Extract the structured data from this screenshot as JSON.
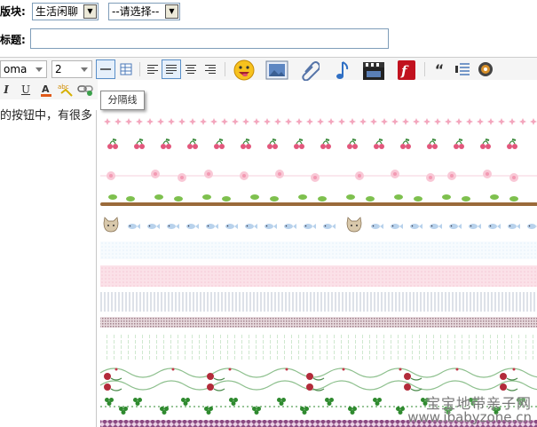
{
  "form": {
    "board_label": "版块:",
    "board_value": "生活闲聊",
    "sub_value": "--请选择--",
    "title_label": "标题:"
  },
  "editor": {
    "font_value": "oma",
    "size_value": "2",
    "content_text": "的按钮中，有很多"
  },
  "tooltip": {
    "text": "分隔线"
  },
  "watermark": {
    "line1": "宝宝地带亲子网",
    "line2": "www.ibabyzone.cn"
  },
  "dividers": [
    {
      "name": "pink-stars-divider",
      "color": "#f3a6bd"
    },
    {
      "name": "cherries-divider",
      "color": "#e2577c"
    },
    {
      "name": "pink-flowers-divider",
      "color": "#f6b9cc"
    },
    {
      "name": "vine-branch-divider",
      "color": "#8b5a2b"
    },
    {
      "name": "cat-fish-divider",
      "color": "#a9c8e6"
    },
    {
      "name": "light-blue-dots-divider",
      "color": "#d9ebf7"
    },
    {
      "name": "pink-band-divider",
      "color": "#fbe1e8"
    },
    {
      "name": "grey-dashed-divider",
      "color": "#d0d4dc"
    },
    {
      "name": "mauve-check-divider",
      "color": "#b79aa3"
    },
    {
      "name": "green-dotted-divider",
      "color": "#cfe8cf"
    },
    {
      "name": "green-swirl-divider",
      "color": "#7fb27f"
    },
    {
      "name": "rose-vine-divider",
      "color": "#b22b3a"
    },
    {
      "name": "clover-divider",
      "color": "#2f8a2f"
    },
    {
      "name": "purple-diamond-divider",
      "color": "#8a4a82"
    }
  ]
}
